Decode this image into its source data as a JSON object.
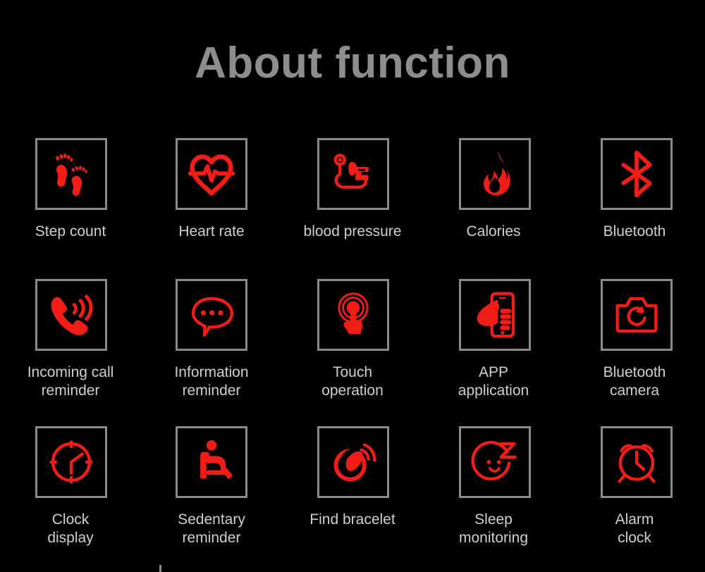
{
  "page": {
    "title": "About function",
    "background_color": "#000000",
    "title_color": "#8d8d8d",
    "accent_color": "#f41c17",
    "box_border_color": "#8a8a8a",
    "label_color": "#cfcfcf"
  },
  "features": [
    {
      "icon": "footprints-icon",
      "label": "Step count"
    },
    {
      "icon": "heart-pulse-icon",
      "label": "Heart rate"
    },
    {
      "icon": "blood-pressure-icon",
      "label": "blood pressure"
    },
    {
      "icon": "flame-icon",
      "label": "Calories"
    },
    {
      "icon": "bluetooth-icon",
      "label": "Bluetooth"
    },
    {
      "icon": "ringing-phone-icon",
      "label": "Incoming call\nreminder"
    },
    {
      "icon": "speech-bubble-icon",
      "label": "Information\nreminder"
    },
    {
      "icon": "touch-gesture-icon",
      "label": "Touch\noperation"
    },
    {
      "icon": "hand-phone-icon",
      "label": "APP\napplication"
    },
    {
      "icon": "camera-icon",
      "label": "Bluetooth\ncamera"
    },
    {
      "icon": "clock-icon",
      "label": "Clock\ndisplay"
    },
    {
      "icon": "seated-person-icon",
      "label": "Sedentary\nreminder"
    },
    {
      "icon": "vibrating-band-icon",
      "label": "Find bracelet"
    },
    {
      "icon": "sleeping-face-icon",
      "label": "Sleep\nmonitoring"
    },
    {
      "icon": "alarm-clock-icon",
      "label": "Alarm\nclock"
    }
  ]
}
